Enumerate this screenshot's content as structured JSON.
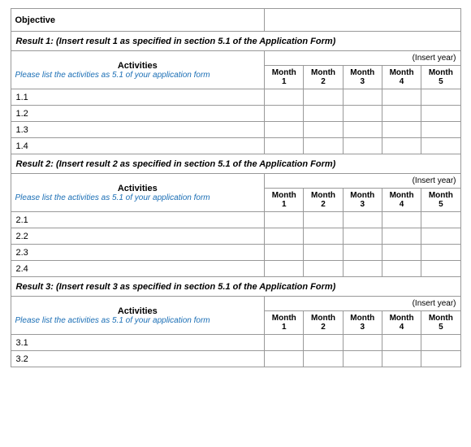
{
  "table": {
    "objective_label": "Objective",
    "results": [
      {
        "label": "Result 1: (Insert result 1 as  specified in section 5.1 of the Application Form)",
        "insert_year": "(Insert year)",
        "activities_label": "Activities",
        "activities_sub": "Please list the activities as 5.1 of your application form",
        "months": [
          {
            "label": "Month",
            "num": "1"
          },
          {
            "label": "Month",
            "num": "2"
          },
          {
            "label": "Month",
            "num": "3"
          },
          {
            "label": "Month",
            "num": "4"
          },
          {
            "label": "Month",
            "num": "5"
          }
        ],
        "rows": [
          "1.1",
          "1.2",
          "1.3",
          "1.4"
        ]
      },
      {
        "label": "Result 2: (Insert result 2 as specified in section 5.1 of the Application Form)",
        "insert_year": "(Insert year)",
        "activities_label": "Activities",
        "activities_sub": "Please list the activities as 5.1 of your application form",
        "months": [
          {
            "label": "Month",
            "num": "1"
          },
          {
            "label": "Month",
            "num": "2"
          },
          {
            "label": "Month",
            "num": "3"
          },
          {
            "label": "Month",
            "num": "4"
          },
          {
            "label": "Month",
            "num": "5"
          }
        ],
        "rows": [
          "2.1",
          "2.2",
          "2.3",
          "2.4"
        ]
      },
      {
        "label": "Result 3: (Insert result 3 as specified in section 5.1 of the Application Form)",
        "insert_year": "(Insert year)",
        "activities_label": "Activities",
        "activities_sub": "Please list the activities as 5.1 of your application form",
        "months": [
          {
            "label": "Month",
            "num": "1"
          },
          {
            "label": "Month",
            "num": "2"
          },
          {
            "label": "Month",
            "num": "3"
          },
          {
            "label": "Month",
            "num": "4"
          },
          {
            "label": "Month",
            "num": "5"
          }
        ],
        "rows": [
          "3.1",
          "3.2"
        ]
      }
    ]
  }
}
